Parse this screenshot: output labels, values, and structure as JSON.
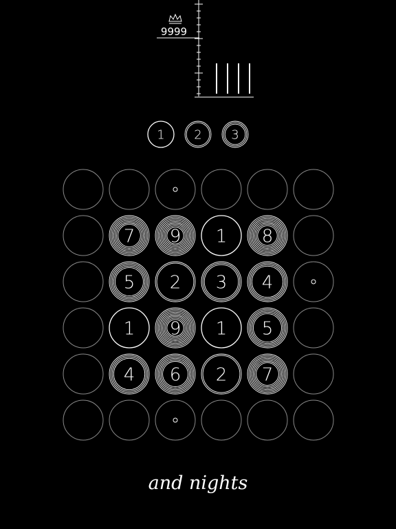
{
  "hud": {
    "crown_icon": "crown-icon",
    "high_score": "9999",
    "tally_marks": 4
  },
  "level_selector": {
    "items": [
      {
        "label": "1",
        "rings": 1
      },
      {
        "label": "2",
        "rings": 2
      },
      {
        "label": "3",
        "rings": 3
      }
    ]
  },
  "board": {
    "rows": [
      [
        {
          "value": "",
          "rings": 1
        },
        {
          "value": "",
          "rings": 1
        },
        {
          "value": "",
          "rings": 1,
          "dot": true
        },
        {
          "value": "",
          "rings": 1
        },
        {
          "value": "",
          "rings": 1
        },
        {
          "value": "",
          "rings": 1
        }
      ],
      [
        {
          "value": "",
          "rings": 1
        },
        {
          "value": "7",
          "rings": 7
        },
        {
          "value": "9",
          "rings": 9
        },
        {
          "value": "1",
          "rings": 1
        },
        {
          "value": "8",
          "rings": 8
        },
        {
          "value": "",
          "rings": 1
        }
      ],
      [
        {
          "value": "",
          "rings": 1
        },
        {
          "value": "5",
          "rings": 5
        },
        {
          "value": "2",
          "rings": 2
        },
        {
          "value": "3",
          "rings": 3
        },
        {
          "value": "4",
          "rings": 4
        },
        {
          "value": "",
          "rings": 1,
          "dot": true
        }
      ],
      [
        {
          "value": "",
          "rings": 1
        },
        {
          "value": "1",
          "rings": 1
        },
        {
          "value": "9",
          "rings": 9
        },
        {
          "value": "1",
          "rings": 1
        },
        {
          "value": "5",
          "rings": 5
        },
        {
          "value": "",
          "rings": 1
        }
      ],
      [
        {
          "value": "",
          "rings": 1
        },
        {
          "value": "4",
          "rings": 4
        },
        {
          "value": "6",
          "rings": 6
        },
        {
          "value": "2",
          "rings": 2
        },
        {
          "value": "7",
          "rings": 7
        },
        {
          "value": "",
          "rings": 1
        }
      ],
      [
        {
          "value": "",
          "rings": 1
        },
        {
          "value": "",
          "rings": 1
        },
        {
          "value": "",
          "rings": 1,
          "dot": true
        },
        {
          "value": "",
          "rings": 1
        },
        {
          "value": "",
          "rings": 1
        },
        {
          "value": "",
          "rings": 1
        }
      ]
    ]
  },
  "tagline": "and nights",
  "colors": {
    "background": "#000000",
    "foreground": "#ffffff",
    "empty_ring": "#8a8a8a"
  }
}
